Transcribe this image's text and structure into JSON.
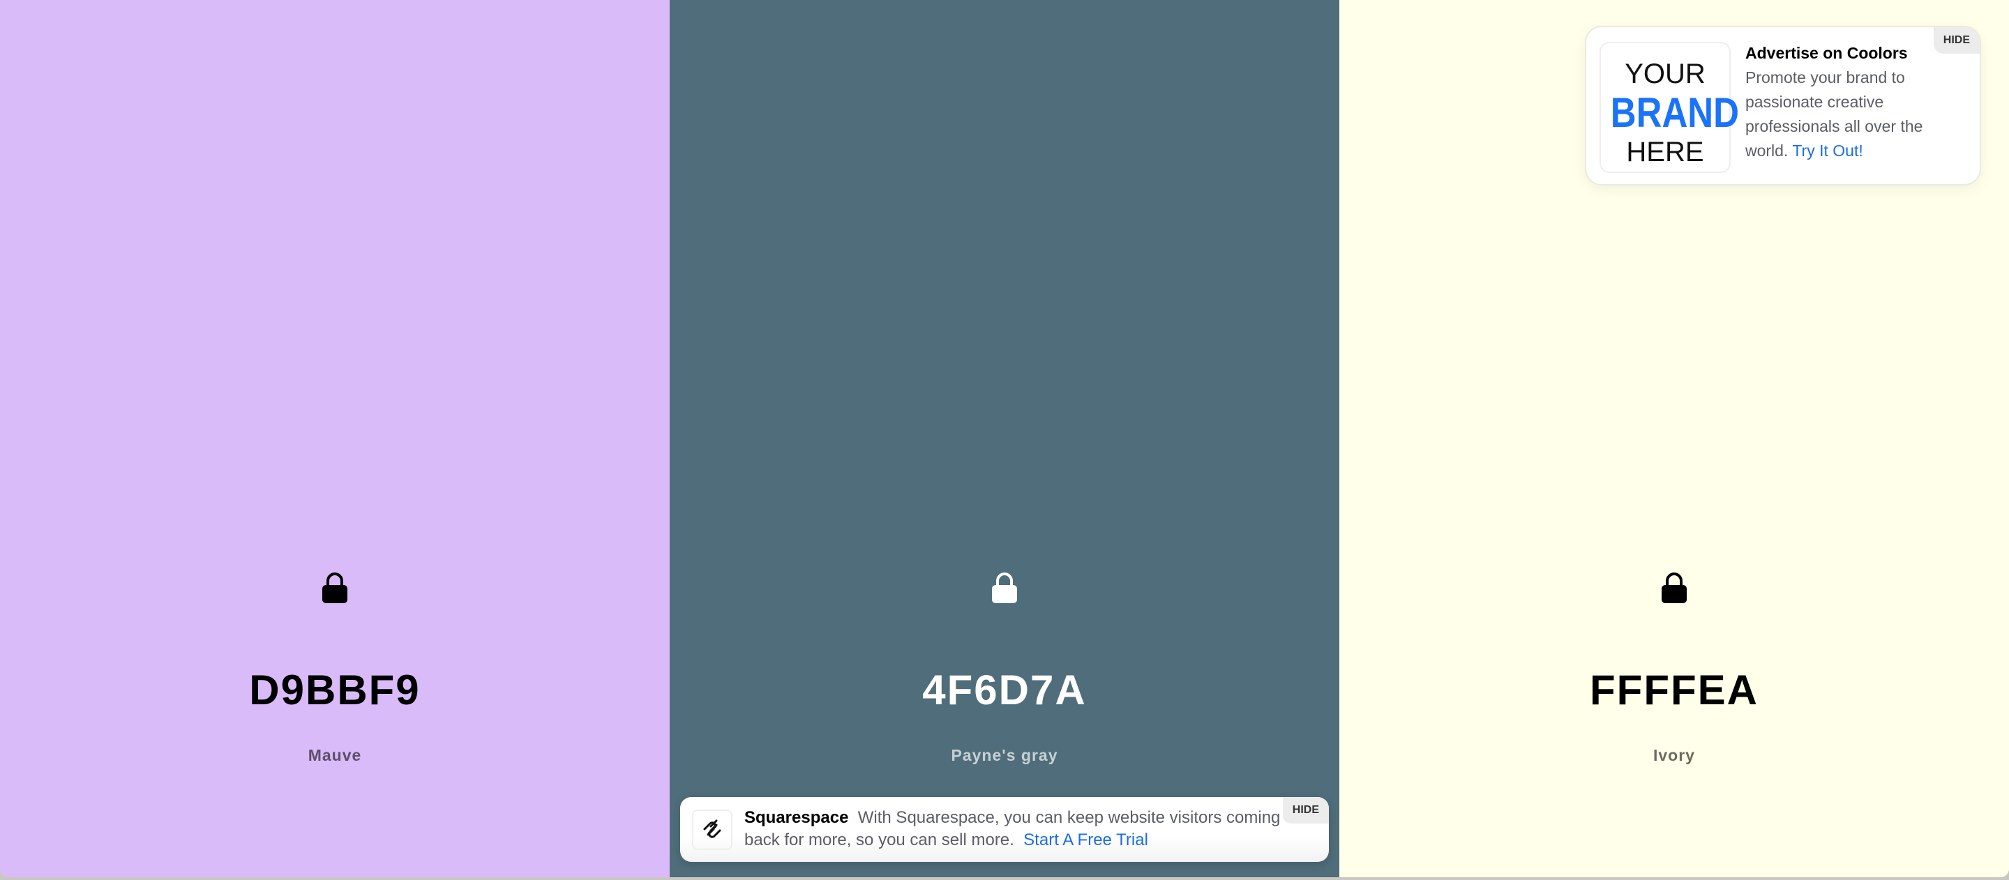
{
  "colors": [
    {
      "hex": "D9BBF9",
      "name": "Mauve",
      "bg": "#d9bbf9",
      "fg": "#000000",
      "sub": "#5d4f6b"
    },
    {
      "hex": "4F6D7A",
      "name": "Payne's gray",
      "bg": "#4f6d7a",
      "fg": "#ffffff",
      "sub": "#c7d0d4"
    },
    {
      "hex": "FFFFEA",
      "name": "Ivory",
      "bg": "#ffffea",
      "fg": "#000000",
      "sub": "#6b6b60"
    }
  ],
  "ad": {
    "hide": "HIDE",
    "brand_top": "YOUR",
    "brand_mid": "BRAND",
    "brand_bottom": "HERE",
    "title": "Advertise on Coolors",
    "body": "Promote your brand to passionate creative professionals all over the world.",
    "link": "Try It Out!"
  },
  "sponsor": {
    "hide": "HIDE",
    "name": "Squarespace",
    "body": "With Squarespace, you can keep website visitors coming back for more, so you can sell more.",
    "link": "Start A Free Trial"
  }
}
